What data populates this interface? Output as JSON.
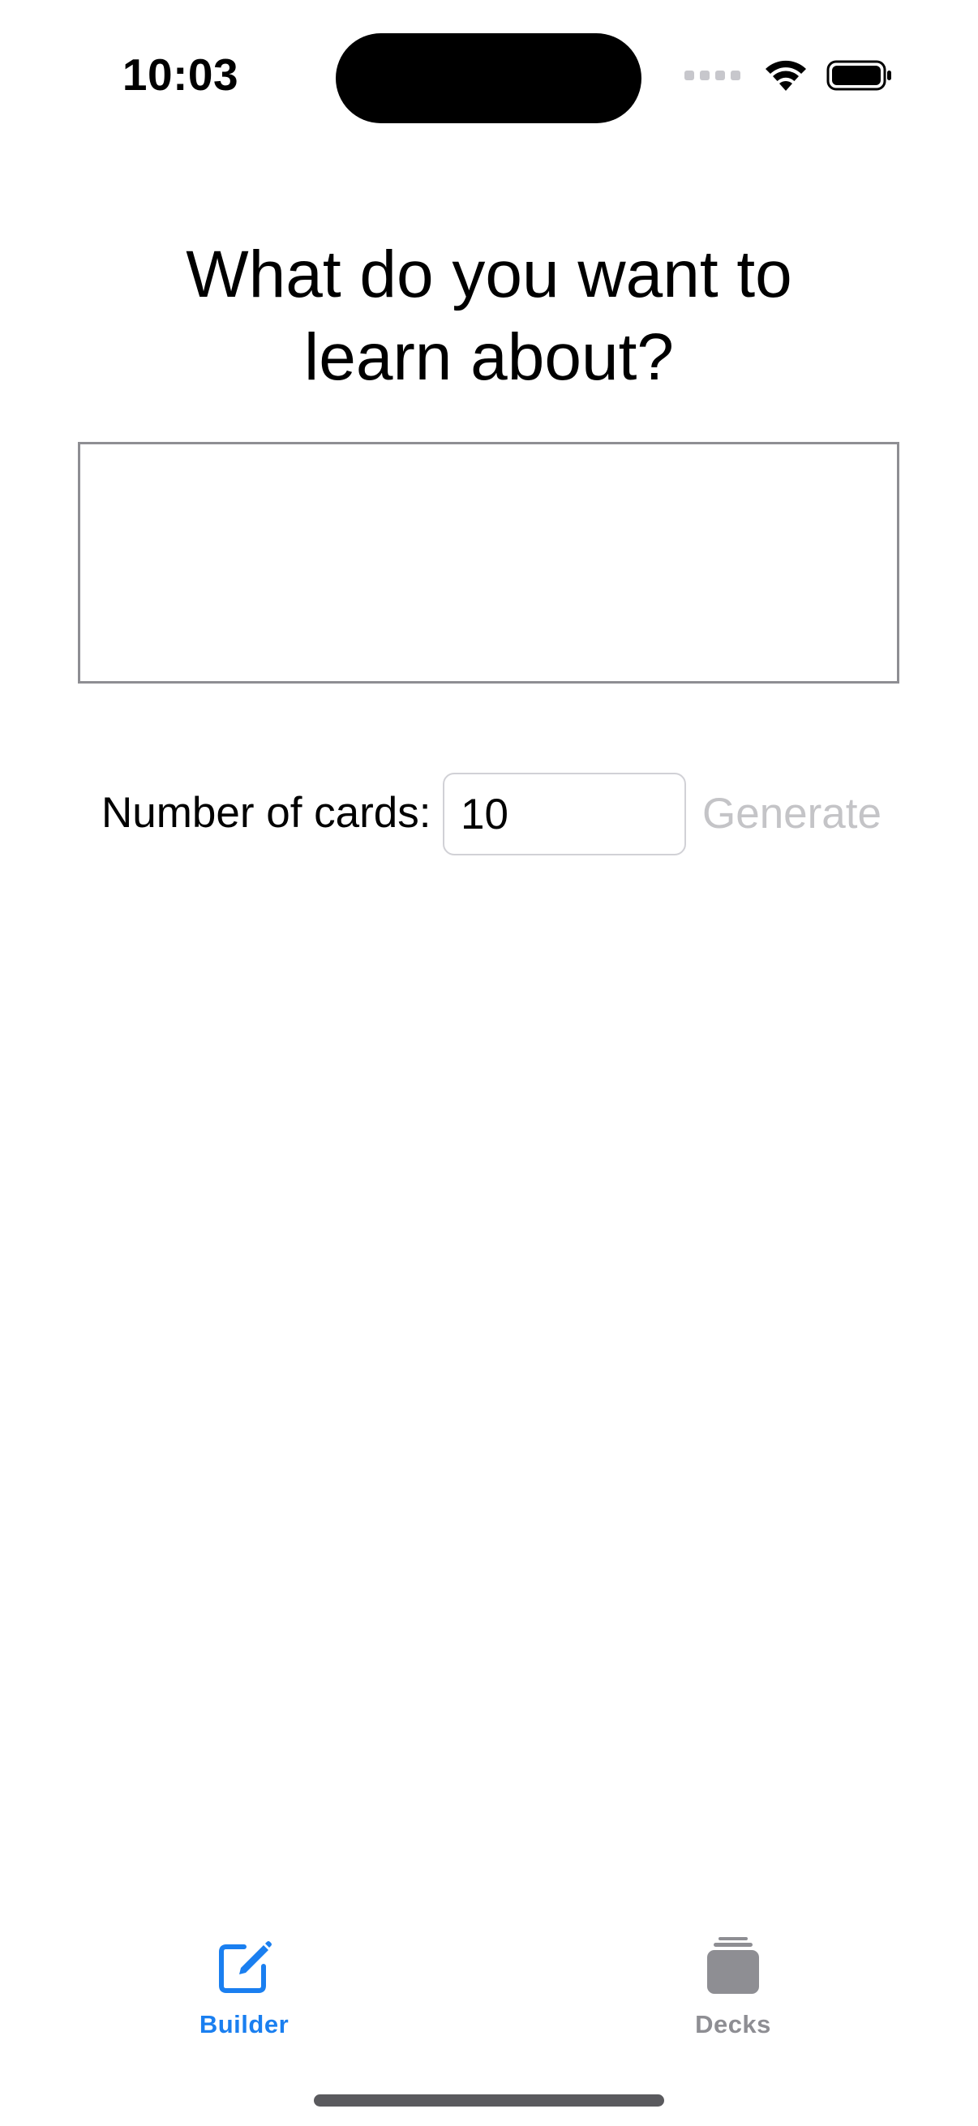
{
  "status_bar": {
    "time": "10:03",
    "icons": [
      "cellular-signal-icon",
      "wifi-icon",
      "battery-icon"
    ]
  },
  "builder": {
    "title": "What do you want to learn about?",
    "topic_input": {
      "value": "",
      "placeholder": ""
    },
    "card_count": {
      "label": "Number of cards:",
      "value": "10"
    },
    "generate_label": "Generate",
    "generate_enabled": false
  },
  "tab_bar": {
    "items": [
      {
        "label": "Builder",
        "icon": "square-pencil-icon",
        "selected": true
      },
      {
        "label": "Decks",
        "icon": "stacked-cards-icon",
        "selected": false
      }
    ]
  },
  "colors": {
    "accent": "#1a7ff0",
    "inactive": "#8e8e93",
    "disabled_text": "#c4c4c7"
  }
}
